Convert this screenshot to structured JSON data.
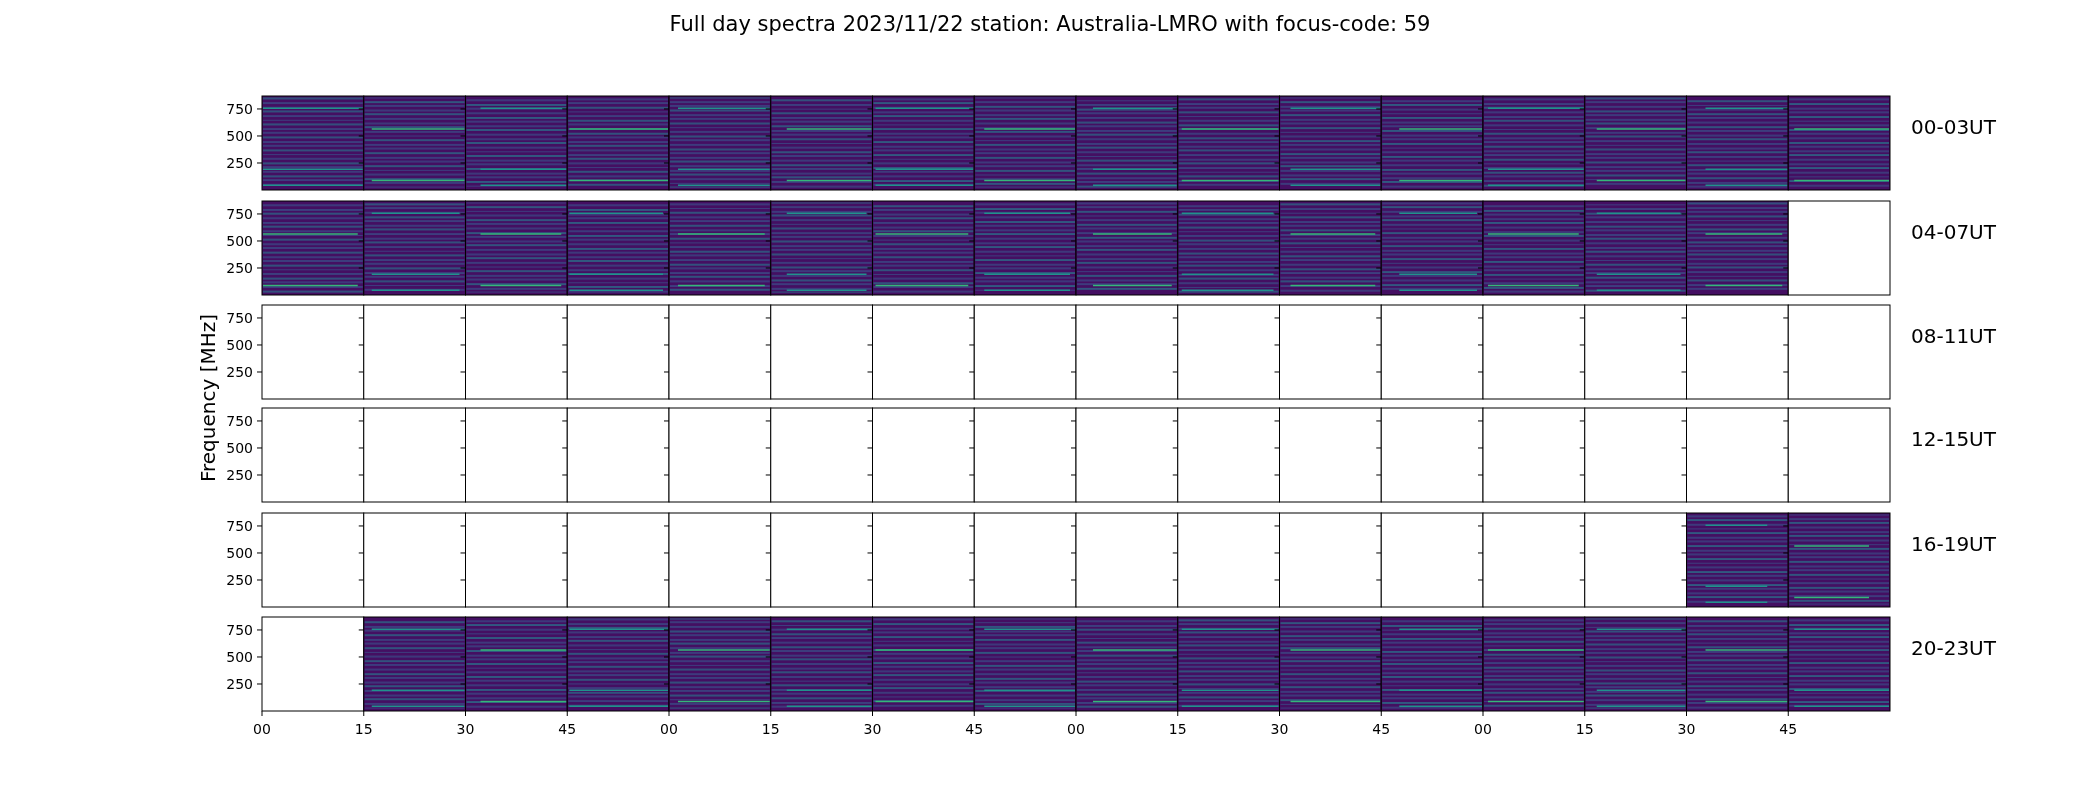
{
  "title": "Full day spectra 2023/11/22 station: Australia-LMRO with focus-code: 59",
  "y_axis_label": "Frequency [MHz]",
  "x_tick_labels": [
    "00",
    "15",
    "30",
    "45",
    "00",
    "15",
    "30",
    "45",
    "00",
    "15",
    "30",
    "45",
    "00",
    "15",
    "30",
    "45"
  ],
  "rows": [
    {
      "label": "00-03UT",
      "y_tick_labels": [
        "750",
        "500",
        "250"
      ],
      "panels": [
        {
          "has_data": true
        },
        {
          "has_data": true
        },
        {
          "has_data": true
        },
        {
          "has_data": true
        },
        {
          "has_data": true
        },
        {
          "has_data": true
        },
        {
          "has_data": true
        },
        {
          "has_data": true
        },
        {
          "has_data": true
        },
        {
          "has_data": true
        },
        {
          "has_data": true
        },
        {
          "has_data": true
        },
        {
          "has_data": true
        },
        {
          "has_data": true
        },
        {
          "has_data": true
        },
        {
          "has_data": true
        }
      ]
    },
    {
      "label": "04-07UT",
      "y_tick_labels": [
        "750",
        "500",
        "250"
      ],
      "panels": [
        {
          "has_data": true
        },
        {
          "has_data": true
        },
        {
          "has_data": true
        },
        {
          "has_data": true
        },
        {
          "has_data": true
        },
        {
          "has_data": true
        },
        {
          "has_data": true
        },
        {
          "has_data": true
        },
        {
          "has_data": true
        },
        {
          "has_data": true
        },
        {
          "has_data": true
        },
        {
          "has_data": true
        },
        {
          "has_data": true
        },
        {
          "has_data": true
        },
        {
          "has_data": true
        },
        {
          "has_data": false
        }
      ]
    },
    {
      "label": "08-11UT",
      "y_tick_labels": [
        "750",
        "500",
        "250"
      ],
      "panels": [
        {
          "has_data": false
        },
        {
          "has_data": false
        },
        {
          "has_data": false
        },
        {
          "has_data": false
        },
        {
          "has_data": false
        },
        {
          "has_data": false
        },
        {
          "has_data": false
        },
        {
          "has_data": false
        },
        {
          "has_data": false
        },
        {
          "has_data": false
        },
        {
          "has_data": false
        },
        {
          "has_data": false
        },
        {
          "has_data": false
        },
        {
          "has_data": false
        },
        {
          "has_data": false
        },
        {
          "has_data": false
        }
      ]
    },
    {
      "label": "12-15UT",
      "y_tick_labels": [
        "750",
        "500",
        "250"
      ],
      "panels": [
        {
          "has_data": false
        },
        {
          "has_data": false
        },
        {
          "has_data": false
        },
        {
          "has_data": false
        },
        {
          "has_data": false
        },
        {
          "has_data": false
        },
        {
          "has_data": false
        },
        {
          "has_data": false
        },
        {
          "has_data": false
        },
        {
          "has_data": false
        },
        {
          "has_data": false
        },
        {
          "has_data": false
        },
        {
          "has_data": false
        },
        {
          "has_data": false
        },
        {
          "has_data": false
        },
        {
          "has_data": false
        }
      ]
    },
    {
      "label": "16-19UT",
      "y_tick_labels": [
        "750",
        "500",
        "250"
      ],
      "panels": [
        {
          "has_data": false
        },
        {
          "has_data": false
        },
        {
          "has_data": false
        },
        {
          "has_data": false
        },
        {
          "has_data": false
        },
        {
          "has_data": false
        },
        {
          "has_data": false
        },
        {
          "has_data": false
        },
        {
          "has_data": false
        },
        {
          "has_data": false
        },
        {
          "has_data": false
        },
        {
          "has_data": false
        },
        {
          "has_data": false
        },
        {
          "has_data": false
        },
        {
          "has_data": true
        },
        {
          "has_data": true
        }
      ]
    },
    {
      "label": "20-23UT",
      "y_tick_labels": [
        "750",
        "500",
        "250"
      ],
      "panels": [
        {
          "has_data": false
        },
        {
          "has_data": true
        },
        {
          "has_data": true
        },
        {
          "has_data": true
        },
        {
          "has_data": true
        },
        {
          "has_data": true
        },
        {
          "has_data": true
        },
        {
          "has_data": true
        },
        {
          "has_data": true
        },
        {
          "has_data": true
        },
        {
          "has_data": true
        },
        {
          "has_data": true
        },
        {
          "has_data": true
        },
        {
          "has_data": true
        },
        {
          "has_data": true
        },
        {
          "has_data": true
        }
      ]
    }
  ]
}
